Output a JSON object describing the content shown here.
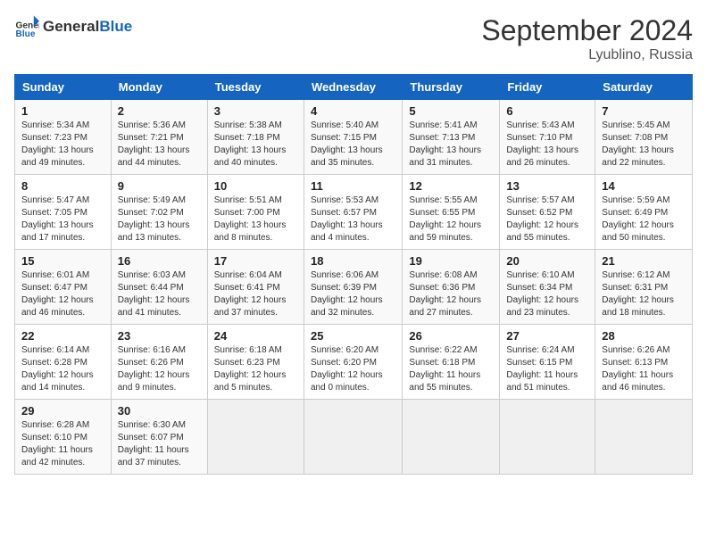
{
  "header": {
    "logo_general": "General",
    "logo_blue": "Blue",
    "month_title": "September 2024",
    "location": "Lyublino, Russia"
  },
  "columns": [
    "Sunday",
    "Monday",
    "Tuesday",
    "Wednesday",
    "Thursday",
    "Friday",
    "Saturday"
  ],
  "weeks": [
    [
      {
        "day": "1",
        "sunrise": "5:34 AM",
        "sunset": "7:23 PM",
        "daylight": "13 hours and 49 minutes"
      },
      {
        "day": "2",
        "sunrise": "5:36 AM",
        "sunset": "7:21 PM",
        "daylight": "13 hours and 44 minutes"
      },
      {
        "day": "3",
        "sunrise": "5:38 AM",
        "sunset": "7:18 PM",
        "daylight": "13 hours and 40 minutes"
      },
      {
        "day": "4",
        "sunrise": "5:40 AM",
        "sunset": "7:15 PM",
        "daylight": "13 hours and 35 minutes"
      },
      {
        "day": "5",
        "sunrise": "5:41 AM",
        "sunset": "7:13 PM",
        "daylight": "13 hours and 31 minutes"
      },
      {
        "day": "6",
        "sunrise": "5:43 AM",
        "sunset": "7:10 PM",
        "daylight": "13 hours and 26 minutes"
      },
      {
        "day": "7",
        "sunrise": "5:45 AM",
        "sunset": "7:08 PM",
        "daylight": "13 hours and 22 minutes"
      }
    ],
    [
      {
        "day": "8",
        "sunrise": "5:47 AM",
        "sunset": "7:05 PM",
        "daylight": "13 hours and 17 minutes"
      },
      {
        "day": "9",
        "sunrise": "5:49 AM",
        "sunset": "7:02 PM",
        "daylight": "13 hours and 13 minutes"
      },
      {
        "day": "10",
        "sunrise": "5:51 AM",
        "sunset": "7:00 PM",
        "daylight": "13 hours and 8 minutes"
      },
      {
        "day": "11",
        "sunrise": "5:53 AM",
        "sunset": "6:57 PM",
        "daylight": "13 hours and 4 minutes"
      },
      {
        "day": "12",
        "sunrise": "5:55 AM",
        "sunset": "6:55 PM",
        "daylight": "12 hours and 59 minutes"
      },
      {
        "day": "13",
        "sunrise": "5:57 AM",
        "sunset": "6:52 PM",
        "daylight": "12 hours and 55 minutes"
      },
      {
        "day": "14",
        "sunrise": "5:59 AM",
        "sunset": "6:49 PM",
        "daylight": "12 hours and 50 minutes"
      }
    ],
    [
      {
        "day": "15",
        "sunrise": "6:01 AM",
        "sunset": "6:47 PM",
        "daylight": "12 hours and 46 minutes"
      },
      {
        "day": "16",
        "sunrise": "6:03 AM",
        "sunset": "6:44 PM",
        "daylight": "12 hours and 41 minutes"
      },
      {
        "day": "17",
        "sunrise": "6:04 AM",
        "sunset": "6:41 PM",
        "daylight": "12 hours and 37 minutes"
      },
      {
        "day": "18",
        "sunrise": "6:06 AM",
        "sunset": "6:39 PM",
        "daylight": "12 hours and 32 minutes"
      },
      {
        "day": "19",
        "sunrise": "6:08 AM",
        "sunset": "6:36 PM",
        "daylight": "12 hours and 27 minutes"
      },
      {
        "day": "20",
        "sunrise": "6:10 AM",
        "sunset": "6:34 PM",
        "daylight": "12 hours and 23 minutes"
      },
      {
        "day": "21",
        "sunrise": "6:12 AM",
        "sunset": "6:31 PM",
        "daylight": "12 hours and 18 minutes"
      }
    ],
    [
      {
        "day": "22",
        "sunrise": "6:14 AM",
        "sunset": "6:28 PM",
        "daylight": "12 hours and 14 minutes"
      },
      {
        "day": "23",
        "sunrise": "6:16 AM",
        "sunset": "6:26 PM",
        "daylight": "12 hours and 9 minutes"
      },
      {
        "day": "24",
        "sunrise": "6:18 AM",
        "sunset": "6:23 PM",
        "daylight": "12 hours and 5 minutes"
      },
      {
        "day": "25",
        "sunrise": "6:20 AM",
        "sunset": "6:20 PM",
        "daylight": "12 hours and 0 minutes"
      },
      {
        "day": "26",
        "sunrise": "6:22 AM",
        "sunset": "6:18 PM",
        "daylight": "11 hours and 55 minutes"
      },
      {
        "day": "27",
        "sunrise": "6:24 AM",
        "sunset": "6:15 PM",
        "daylight": "11 hours and 51 minutes"
      },
      {
        "day": "28",
        "sunrise": "6:26 AM",
        "sunset": "6:13 PM",
        "daylight": "11 hours and 46 minutes"
      }
    ],
    [
      {
        "day": "29",
        "sunrise": "6:28 AM",
        "sunset": "6:10 PM",
        "daylight": "11 hours and 42 minutes"
      },
      {
        "day": "30",
        "sunrise": "6:30 AM",
        "sunset": "6:07 PM",
        "daylight": "11 hours and 37 minutes"
      },
      null,
      null,
      null,
      null,
      null
    ]
  ],
  "labels": {
    "sunrise": "Sunrise:",
    "sunset": "Sunset:",
    "daylight": "Daylight hours"
  }
}
